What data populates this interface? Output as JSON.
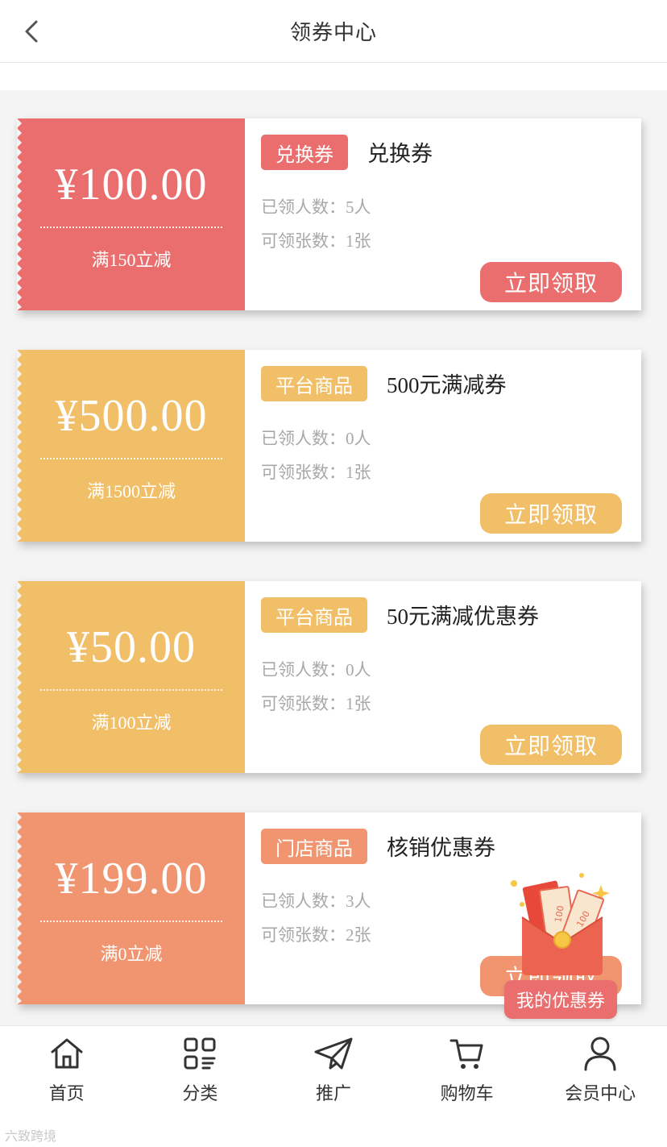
{
  "header": {
    "title": "领券中心"
  },
  "coupons": [
    {
      "amount": "¥100.00",
      "condition": "满150立减",
      "tag": "兑换券",
      "name": "兑换券",
      "received": "已领人数：5人",
      "limit": "可领张数：1张",
      "button": "立即领取",
      "theme": "red",
      "color": "#ea6e6e"
    },
    {
      "amount": "¥500.00",
      "condition": "满1500立减",
      "tag": "平台商品",
      "name": "500元满减券",
      "received": "已领人数：0人",
      "limit": "可领张数：1张",
      "button": "立即领取",
      "theme": "yellow",
      "color": "#f1bf67"
    },
    {
      "amount": "¥50.00",
      "condition": "满100立减",
      "tag": "平台商品",
      "name": "50元满减优惠券",
      "received": "已领人数：0人",
      "limit": "可领张数：1张",
      "button": "立即领取",
      "theme": "yellow",
      "color": "#f1bf67"
    },
    {
      "amount": "¥199.00",
      "condition": "满0立减",
      "tag": "门店商品",
      "name": "核销优惠券",
      "received": "已领人数：3人",
      "limit": "可领张数：2张",
      "button": "立即领取",
      "theme": "salmon",
      "color": "#f09570"
    }
  ],
  "floating": {
    "label": "我的优惠券",
    "icon": "red-envelope-icon"
  },
  "tabbar": [
    {
      "label": "首页",
      "icon": "home-icon"
    },
    {
      "label": "分类",
      "icon": "category-icon"
    },
    {
      "label": "推广",
      "icon": "paper-plane-icon"
    },
    {
      "label": "购物车",
      "icon": "cart-icon"
    },
    {
      "label": "会员中心",
      "icon": "user-icon"
    }
  ],
  "watermark": "六致跨境"
}
